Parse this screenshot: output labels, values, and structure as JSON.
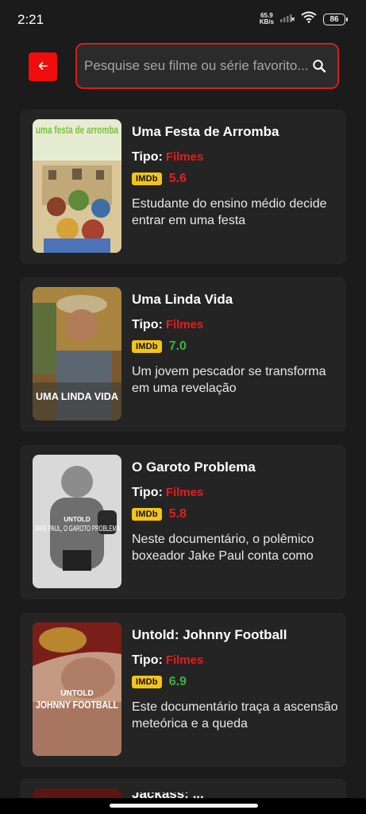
{
  "status_bar": {
    "time": "2:21",
    "net_speed_value": "65.9",
    "net_speed_unit": "KB/s",
    "battery": "86"
  },
  "search": {
    "placeholder": "Pesquise seu filme ou série favorito..."
  },
  "labels": {
    "tipo": "Tipo:",
    "imdb": "IMDb"
  },
  "colors": {
    "accent": "#f20d0d",
    "rating_low": "#e51d1d",
    "rating_high": "#3cb043",
    "imdb_badge": "#f2c418"
  },
  "movies": [
    {
      "title": "Uma Festa de Arromba",
      "type": "Filmes",
      "rating": "5.6",
      "rating_color": "red",
      "description": "Estudante do ensino médio decide entrar em uma festa",
      "poster_text": "uma festa de arromba"
    },
    {
      "title": "Uma Linda Vida",
      "type": "Filmes",
      "rating": "7.0",
      "rating_color": "green",
      "description": "Um jovem pescador se transforma em uma revelação",
      "poster_text": "UMA LINDA VIDA"
    },
    {
      "title": "O Garoto Problema",
      "type": "Filmes",
      "rating": "5.8",
      "rating_color": "red",
      "description": "Neste documentário, o polêmico boxeador Jake Paul conta como",
      "poster_text_top": "UNTOLD",
      "poster_text": "JAKE PAUL, O GAROTO PROBLEMA"
    },
    {
      "title": "Untold: Johnny Football",
      "type": "Filmes",
      "rating": "6.9",
      "rating_color": "green",
      "description": "Este documentário traça a ascensão meteórica e a queda",
      "poster_text_top": "UNTOLD",
      "poster_text": "JOHNNY FOOTBALL"
    }
  ],
  "partial_movie": {
    "title": "Jackass: ..."
  }
}
